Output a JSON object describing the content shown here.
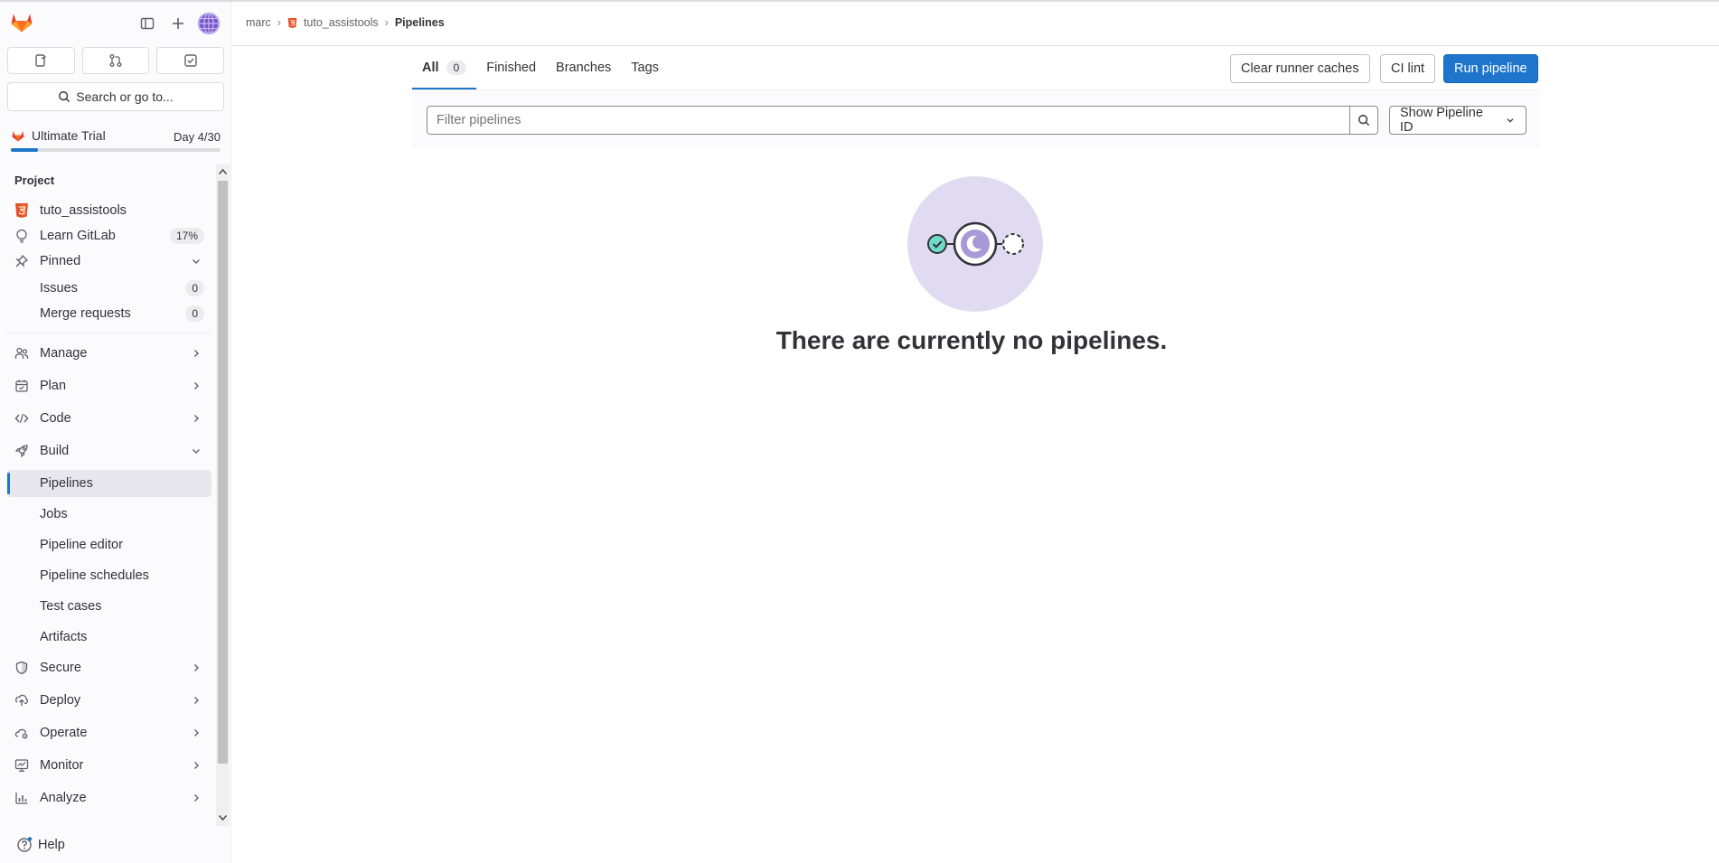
{
  "sidebar": {
    "search_label": "Search or go to...",
    "trial": {
      "label": "Ultimate Trial",
      "day": "Day 4/30",
      "progress": 0.13
    },
    "section_heading": "Project",
    "project": {
      "name": "tuto_assistools"
    },
    "learn": {
      "label": "Learn GitLab",
      "badge": "17%"
    },
    "pinned": {
      "label": "Pinned",
      "items": [
        {
          "label": "Issues",
          "count": "0"
        },
        {
          "label": "Merge requests",
          "count": "0"
        }
      ]
    },
    "groups": [
      {
        "label": "Manage"
      },
      {
        "label": "Plan"
      },
      {
        "label": "Code"
      }
    ],
    "build": {
      "label": "Build",
      "items": [
        {
          "label": "Pipelines"
        },
        {
          "label": "Jobs"
        },
        {
          "label": "Pipeline editor"
        },
        {
          "label": "Pipeline schedules"
        },
        {
          "label": "Test cases"
        },
        {
          "label": "Artifacts"
        }
      ]
    },
    "groups_after": [
      {
        "label": "Secure"
      },
      {
        "label": "Deploy"
      },
      {
        "label": "Operate"
      },
      {
        "label": "Monitor"
      },
      {
        "label": "Analyze"
      }
    ],
    "help": "Help"
  },
  "breadcrumb": [
    "marc",
    "tuto_assistools",
    "Pipelines"
  ],
  "tabs": [
    {
      "label": "All",
      "count": "0"
    },
    {
      "label": "Finished"
    },
    {
      "label": "Branches"
    },
    {
      "label": "Tags"
    }
  ],
  "actions": {
    "clear": "Clear runner caches",
    "lint": "CI lint",
    "run": "Run pipeline"
  },
  "filter": {
    "placeholder": "Filter pipelines",
    "select": "Show Pipeline ID"
  },
  "empty": {
    "title": "There are currently no pipelines."
  },
  "colors": {
    "accent": "#1f75cb",
    "illustration_bg": "#e1dbf1",
    "success": "#6fdac8",
    "logo": "#e24329"
  }
}
